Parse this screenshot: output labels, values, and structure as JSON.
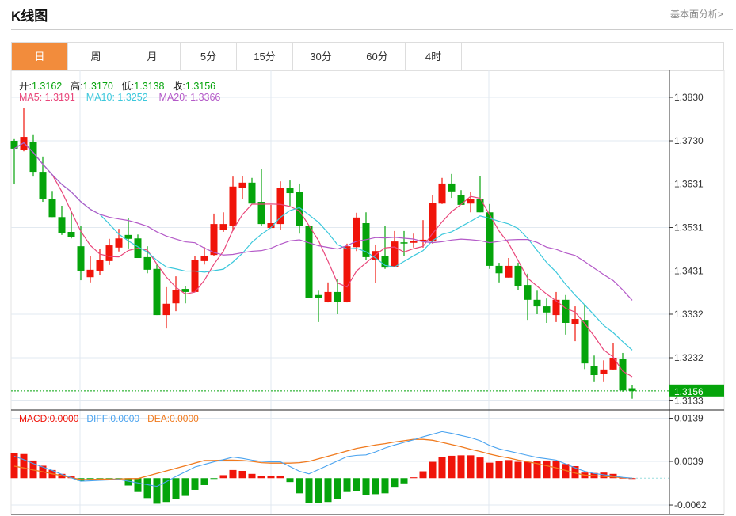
{
  "header": {
    "title": "K线图",
    "link": "基本面分析>"
  },
  "tabs": [
    {
      "label": "日",
      "active": true
    },
    {
      "label": "周"
    },
    {
      "label": "月"
    },
    {
      "label": "5分"
    },
    {
      "label": "15分"
    },
    {
      "label": "30分"
    },
    {
      "label": "60分"
    },
    {
      "label": "4时"
    }
  ],
  "info": {
    "open_label": "开:",
    "open": "1.3162",
    "high_label": "高:",
    "high": "1.3170",
    "low_label": "低:",
    "low": "1.3138",
    "close_label": "收:",
    "close": "1.3156",
    "ma5_label": "MA5: ",
    "ma5": "1.3191",
    "ma10_label": "MA10: ",
    "ma10": "1.3252",
    "ma20_label": "MA20: ",
    "ma20": "1.3366",
    "macd_label": "MACD:",
    "macd": "0.0000",
    "diff_label": "DIFF:",
    "diff": "0.0000",
    "dea_label": "DEA:",
    "dea": "0.0000"
  },
  "colors": {
    "up": "#f0140a",
    "down": "#05a40b",
    "ma5": "#e9467a",
    "ma10": "#3cc8dc",
    "ma20": "#b45ac8",
    "diff": "#4aa3ef",
    "dea": "#f07a1e",
    "active_tab": "#f28c3c",
    "last_price": "#05a40b"
  },
  "chart_data": [
    {
      "type": "candlestick",
      "ylim": [
        1.312,
        1.389
      ],
      "yticks": [
        "1.3830",
        "1.3730",
        "1.3631",
        "1.3531",
        "1.3431",
        "1.3332",
        "1.3232",
        "1.3133"
      ],
      "last_price": "1.3156",
      "grid": true,
      "ohlc": [
        [
          1.373,
          1.3734,
          1.363,
          1.3712
        ],
        [
          1.371,
          1.3805,
          1.3706,
          1.3739
        ],
        [
          1.3728,
          1.3745,
          1.3648,
          1.3659
        ],
        [
          1.3659,
          1.3694,
          1.359,
          1.3596
        ],
        [
          1.3596,
          1.3615,
          1.3555,
          1.3555
        ],
        [
          1.3555,
          1.3581,
          1.3514,
          1.3519
        ],
        [
          1.3521,
          1.3565,
          1.3506,
          1.351
        ],
        [
          1.3488,
          1.3535,
          1.341,
          1.3432
        ],
        [
          1.3417,
          1.3466,
          1.3405,
          1.3434
        ],
        [
          1.3432,
          1.3481,
          1.3421,
          1.3456
        ],
        [
          1.3454,
          1.3505,
          1.3445,
          1.349
        ],
        [
          1.3485,
          1.3528,
          1.3476,
          1.3506
        ],
        [
          1.3514,
          1.3552,
          1.3483,
          1.3505
        ],
        [
          1.3506,
          1.3515,
          1.3461,
          1.3461
        ],
        [
          1.3463,
          1.3488,
          1.3426,
          1.3434
        ],
        [
          1.3436,
          1.3446,
          1.333,
          1.333
        ],
        [
          1.333,
          1.3394,
          1.3299,
          1.3356
        ],
        [
          1.3357,
          1.3419,
          1.3339,
          1.3388
        ],
        [
          1.339,
          1.3397,
          1.3357,
          1.3383
        ],
        [
          1.3383,
          1.3466,
          1.3383,
          1.3457
        ],
        [
          1.3454,
          1.3486,
          1.3446,
          1.3466
        ],
        [
          1.3468,
          1.3563,
          1.3466,
          1.3539
        ],
        [
          1.3526,
          1.3566,
          1.3521,
          1.3539
        ],
        [
          1.3534,
          1.3648,
          1.3523,
          1.3625
        ],
        [
          1.3621,
          1.365,
          1.3597,
          1.3634
        ],
        [
          1.3634,
          1.3645,
          1.3586,
          1.3586
        ],
        [
          1.359,
          1.3666,
          1.3535,
          1.3539
        ],
        [
          1.353,
          1.3583,
          1.353,
          1.3541
        ],
        [
          1.3539,
          1.3637,
          1.3526,
          1.3621
        ],
        [
          1.3621,
          1.3639,
          1.3581,
          1.361
        ],
        [
          1.3612,
          1.3632,
          1.3517,
          1.3535
        ],
        [
          1.3534,
          1.3534,
          1.337,
          1.337
        ],
        [
          1.3376,
          1.3386,
          1.3314,
          1.337
        ],
        [
          1.3361,
          1.3405,
          1.3359,
          1.3383
        ],
        [
          1.3383,
          1.3412,
          1.3332,
          1.3361
        ],
        [
          1.3361,
          1.3494,
          1.3359,
          1.3488
        ],
        [
          1.3486,
          1.3565,
          1.3477,
          1.3554
        ],
        [
          1.3541,
          1.3566,
          1.3457,
          1.3463
        ],
        [
          1.3457,
          1.3492,
          1.3403,
          1.3477
        ],
        [
          1.3465,
          1.3534,
          1.3436,
          1.3439
        ],
        [
          1.3441,
          1.3523,
          1.3441,
          1.3499
        ],
        [
          1.3497,
          1.3523,
          1.3466,
          1.3496
        ],
        [
          1.3496,
          1.3517,
          1.3485,
          1.3501
        ],
        [
          1.3499,
          1.3548,
          1.3485,
          1.3503
        ],
        [
          1.3499,
          1.3605,
          1.3494,
          1.3588
        ],
        [
          1.3586,
          1.3645,
          1.3585,
          1.3632
        ],
        [
          1.3632,
          1.3654,
          1.3599,
          1.3614
        ],
        [
          1.3605,
          1.3617,
          1.3583,
          1.3583
        ],
        [
          1.3586,
          1.3612,
          1.3566,
          1.3596
        ],
        [
          1.3597,
          1.365,
          1.3566,
          1.3566
        ],
        [
          1.3566,
          1.3585,
          1.3436,
          1.3443
        ],
        [
          1.3443,
          1.345,
          1.3405,
          1.3426
        ],
        [
          1.3416,
          1.3461,
          1.3416,
          1.3443
        ],
        [
          1.3443,
          1.345,
          1.3388,
          1.3397
        ],
        [
          1.3399,
          1.3425,
          1.3319,
          1.3365
        ],
        [
          1.3365,
          1.3386,
          1.3332,
          1.335
        ],
        [
          1.335,
          1.3368,
          1.3312,
          1.3336
        ],
        [
          1.333,
          1.3383,
          1.3314,
          1.3365
        ],
        [
          1.3365,
          1.3376,
          1.3285,
          1.3312
        ],
        [
          1.331,
          1.335,
          1.327,
          1.3321
        ],
        [
          1.3319,
          1.3354,
          1.3206,
          1.3219
        ],
        [
          1.3212,
          1.3237,
          1.3176,
          1.3192
        ],
        [
          1.3194,
          1.3226,
          1.3176,
          1.3205
        ],
        [
          1.3205,
          1.3266,
          1.3203,
          1.3232
        ],
        [
          1.323,
          1.3243,
          1.3154,
          1.3157
        ],
        [
          1.3162,
          1.317,
          1.3138,
          1.3156
        ]
      ],
      "moving_averages": [
        {
          "name": "MA5",
          "period": 5
        },
        {
          "name": "MA10",
          "period": 10
        },
        {
          "name": "MA20",
          "period": 20
        }
      ]
    },
    {
      "type": "macd",
      "ylim": [
        -0.0081,
        0.0158
      ],
      "yticks": [
        "0.0139",
        "0.0039",
        "-0.0062"
      ],
      "grid": true,
      "histogram": [
        0.0059,
        0.0056,
        0.0041,
        0.0029,
        0.0019,
        0.001,
        0.0004,
        -0.0006,
        -0.0002,
        -0.0002,
        -0.0002,
        -0.0001,
        -0.0017,
        -0.0032,
        -0.0046,
        -0.0059,
        -0.0055,
        -0.0048,
        -0.0041,
        -0.0027,
        -0.0016,
        -0.0001,
        0.0007,
        0.0019,
        0.0017,
        0.001,
        0.0005,
        0.0006,
        0.0006,
        -0.0009,
        -0.0035,
        -0.0058,
        -0.0058,
        -0.0055,
        -0.0048,
        -0.0032,
        -0.003,
        -0.0039,
        -0.0037,
        -0.0035,
        -0.002,
        -0.0012,
        0.0002,
        0.0016,
        0.0038,
        0.0049,
        0.0052,
        0.0053,
        0.0053,
        0.0048,
        0.0036,
        0.004,
        0.0042,
        0.0038,
        0.0038,
        0.0039,
        0.0041,
        0.0041,
        0.0033,
        0.0028,
        0.0013,
        0.0012,
        0.0013,
        0.001,
        0.0001,
        0.0
      ],
      "diff": [
        0.0051,
        0.0043,
        0.0034,
        0.0026,
        0.0018,
        0.0009,
        0.0001,
        -0.0007,
        -0.0006,
        -0.0005,
        -0.0004,
        -0.0003,
        -0.0007,
        -0.0011,
        -0.0015,
        -0.0019,
        -0.0008,
        0.0004,
        0.0015,
        0.0026,
        0.0032,
        0.0038,
        0.0043,
        0.0049,
        0.0046,
        0.0042,
        0.0039,
        0.0038,
        0.0038,
        0.0027,
        0.0016,
        0.001,
        0.002,
        0.003,
        0.004,
        0.005,
        0.0053,
        0.0054,
        0.0061,
        0.007,
        0.0077,
        0.0083,
        0.0089,
        0.0096,
        0.0102,
        0.0108,
        0.0104,
        0.0099,
        0.0094,
        0.0087,
        0.0076,
        0.0068,
        0.0063,
        0.0058,
        0.0053,
        0.0048,
        0.0045,
        0.0042,
        0.0033,
        0.0024,
        0.0016,
        0.0011,
        0.0008,
        0.0005,
        0.0002,
        0.0
      ],
      "dea": [
        0.0028,
        0.0024,
        0.0019,
        0.0015,
        0.001,
        0.0006,
        0.0001,
        -0.0003,
        -0.0003,
        -0.0002,
        -0.0002,
        -0.0002,
        -0.0001,
        -0.0001,
        0.0005,
        0.0011,
        0.0017,
        0.0023,
        0.0029,
        0.0035,
        0.0041,
        0.0041,
        0.0042,
        0.0042,
        0.0041,
        0.0039,
        0.0036,
        0.0035,
        0.0035,
        0.0035,
        0.0036,
        0.0039,
        0.0045,
        0.0051,
        0.0057,
        0.0063,
        0.0069,
        0.0073,
        0.0077,
        0.008,
        0.0084,
        0.0087,
        0.009,
        0.009,
        0.0088,
        0.0083,
        0.0078,
        0.0073,
        0.0067,
        0.0062,
        0.0056,
        0.0051,
        0.0047,
        0.0042,
        0.0038,
        0.0034,
        0.0029,
        0.0024,
        0.0018,
        0.0012,
        0.0007,
        0.0006,
        0.0004,
        0.0003,
        0.0001,
        0.0
      ]
    }
  ]
}
